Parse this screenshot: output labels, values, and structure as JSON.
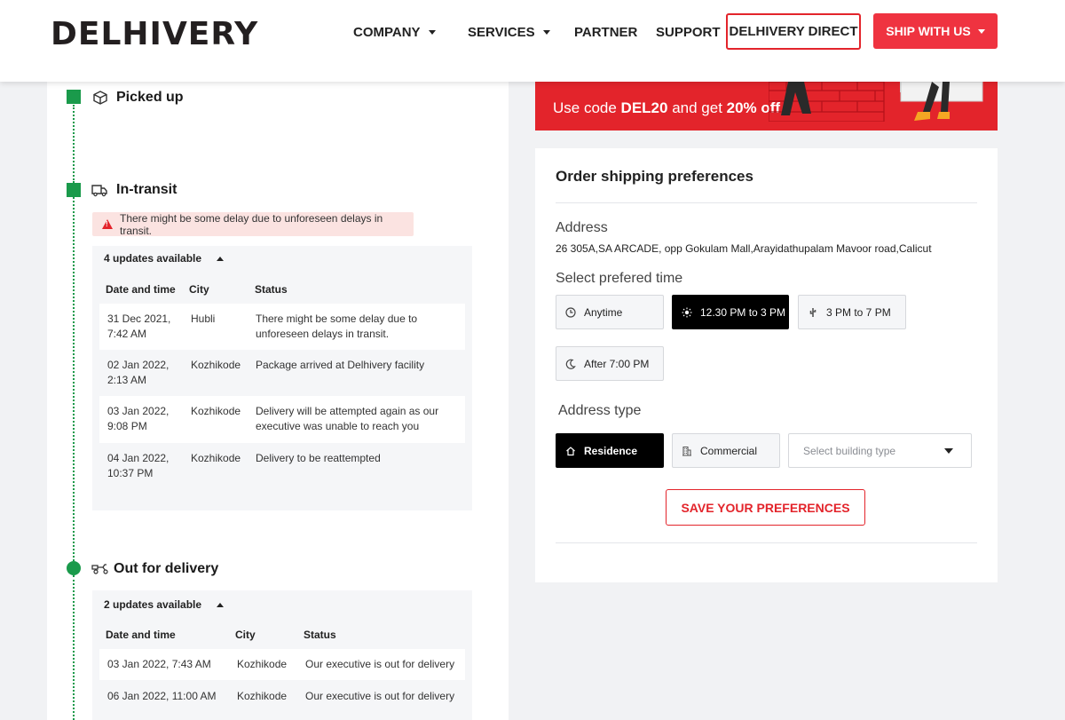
{
  "header": {
    "logo": "DELHIVERY",
    "nav": {
      "company": "COMPANY",
      "services": "SERVICES",
      "partner": "PARTNER",
      "support": "SUPPORT",
      "direct": "DELHIVERY DIRECT",
      "ship": "SHIP WITH US"
    }
  },
  "timeline": {
    "picked_up": "Picked up",
    "in_transit": {
      "title": "In-transit",
      "alert": "There might be some delay due to unforeseen delays in transit.",
      "updates_label": "4 updates available",
      "columns": [
        "Date and time",
        "City",
        "Status"
      ],
      "rows": [
        {
          "date1": "31 Dec 2021,",
          "date2": "7:42 AM",
          "city": "Hubli",
          "status1": "There might be some delay due to",
          "status2": "unforeseen delays in transit."
        },
        {
          "date1": "02 Jan 2022,",
          "date2": "2:13 AM",
          "city": "Kozhikode",
          "status1": "Package arrived at Delhivery facility",
          "status2": ""
        },
        {
          "date1": "03 Jan 2022,",
          "date2": "9:08 PM",
          "city": "Kozhikode",
          "status1": "Delivery will be attempted again as our",
          "status2": "executive was unable to reach you"
        },
        {
          "date1": "04 Jan 2022,",
          "date2": "10:37 PM",
          "city": "Kozhikode",
          "status1": "Delivery to be reattempted",
          "status2": ""
        }
      ]
    },
    "out_for_delivery": {
      "title": "Out for delivery",
      "updates_label": "2 updates available",
      "columns": [
        "Date and time",
        "City",
        "Status"
      ],
      "rows": [
        {
          "date": "03 Jan 2022, 7:43 AM",
          "city": "Kozhikode",
          "status": "Our executive is out for delivery"
        },
        {
          "date": "06 Jan 2022, 11:00 AM",
          "city": "Kozhikode",
          "status": "Our executive is out for delivery"
        }
      ]
    }
  },
  "promo": {
    "prefix": "Use code ",
    "code": "DEL20",
    "middle": " and get ",
    "discount": "20% off"
  },
  "preferences": {
    "title": "Order shipping preferences",
    "address_label": "Address",
    "address": "26 305A,SA ARCADE, opp Gokulam Mall,Arayidathupalam Mavoor road,Calicut",
    "time_label": "Select prefered time",
    "times": [
      "Anytime",
      "12.30 PM to 3 PM",
      "3 PM to 7 PM",
      "After 7:00 PM"
    ],
    "selected_time": "12.30 PM to 3 PM",
    "address_type_label": "Address type",
    "address_types": [
      "Residence",
      "Commercial"
    ],
    "selected_address_type": "Residence",
    "building_placeholder": "Select building type",
    "save": "SAVE YOUR PREFERENCES"
  },
  "colors": {
    "brand_red": "#e3242b",
    "timeline_green": "#1a9a4b",
    "active_option": "#000000"
  }
}
